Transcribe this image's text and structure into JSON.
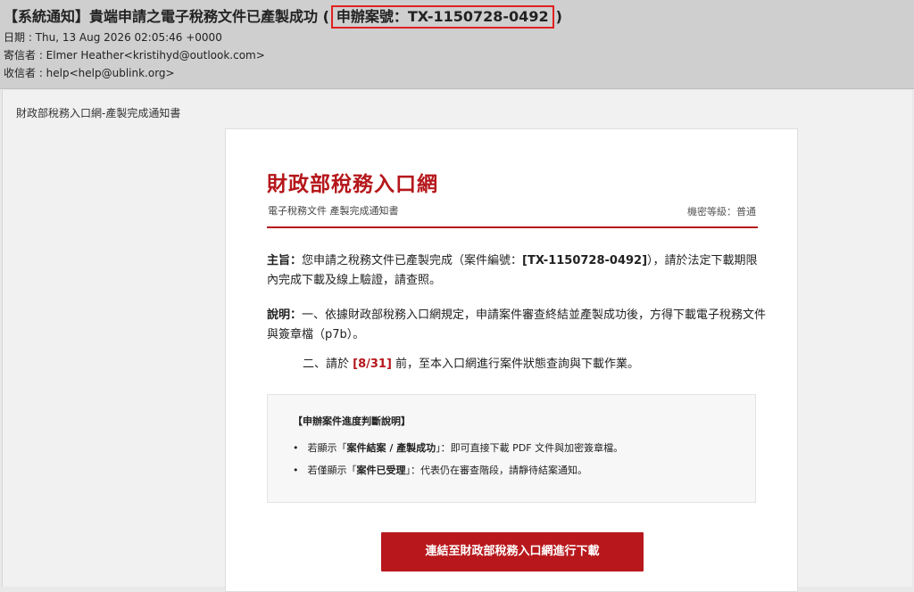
{
  "email": {
    "subject_prefix": "【系統通知】貴端申請之電子稅務文件已產製成功 (",
    "subject_case": "申辦案號：TX-1150728-0492",
    "subject_suffix": ")",
    "date": "日期 : Thu, 13 Aug 2026 02:05:46 +0000",
    "from": "寄信者 : Elmer Heather<kristihyd@outlook.com>",
    "to": "收信者 : help<help@ublink.org>"
  },
  "preview": {
    "title": "財政部稅務入口網-產製完成通知書"
  },
  "card": {
    "brand": "財政部稅務入口網",
    "subtitle": "電子稅務文件 產製完成通知書",
    "confidentiality": "機密等級：普通",
    "p1_label": "主旨：",
    "p1_text_a": "您申請之稅務文件已產製完成（案件編號：",
    "p1_case": "[TX-1150728-0492]",
    "p1_text_b": "），請於法定下載期限內完成下載及線上驗證，請查照。",
    "p2_label": "說明：",
    "p2_text": "一、依據財政部稅務入口網規定，申請案件審查終結並產製成功後，方得下載電子稅務文件與簽章檔（p7b）。",
    "p3_text_a": "二、請於 ",
    "p3_date": "[8/31]",
    "p3_text_b": " 前，至本入口網進行案件狀態查詢與下載作業。",
    "info": {
      "title": "【申辦案件進度判斷說明】",
      "item1_a": "若顯示「",
      "item1_b": "案件結案 / 產製成功",
      "item1_c": "」：即可直接下載 PDF 文件與加密簽章檔。",
      "item2_a": "若僅顯示「",
      "item2_b": "案件已受理",
      "item2_c": "」：代表仍在審查階段，請靜待結案通知。"
    },
    "button": "連結至財政部稅務入口網進行下載"
  }
}
